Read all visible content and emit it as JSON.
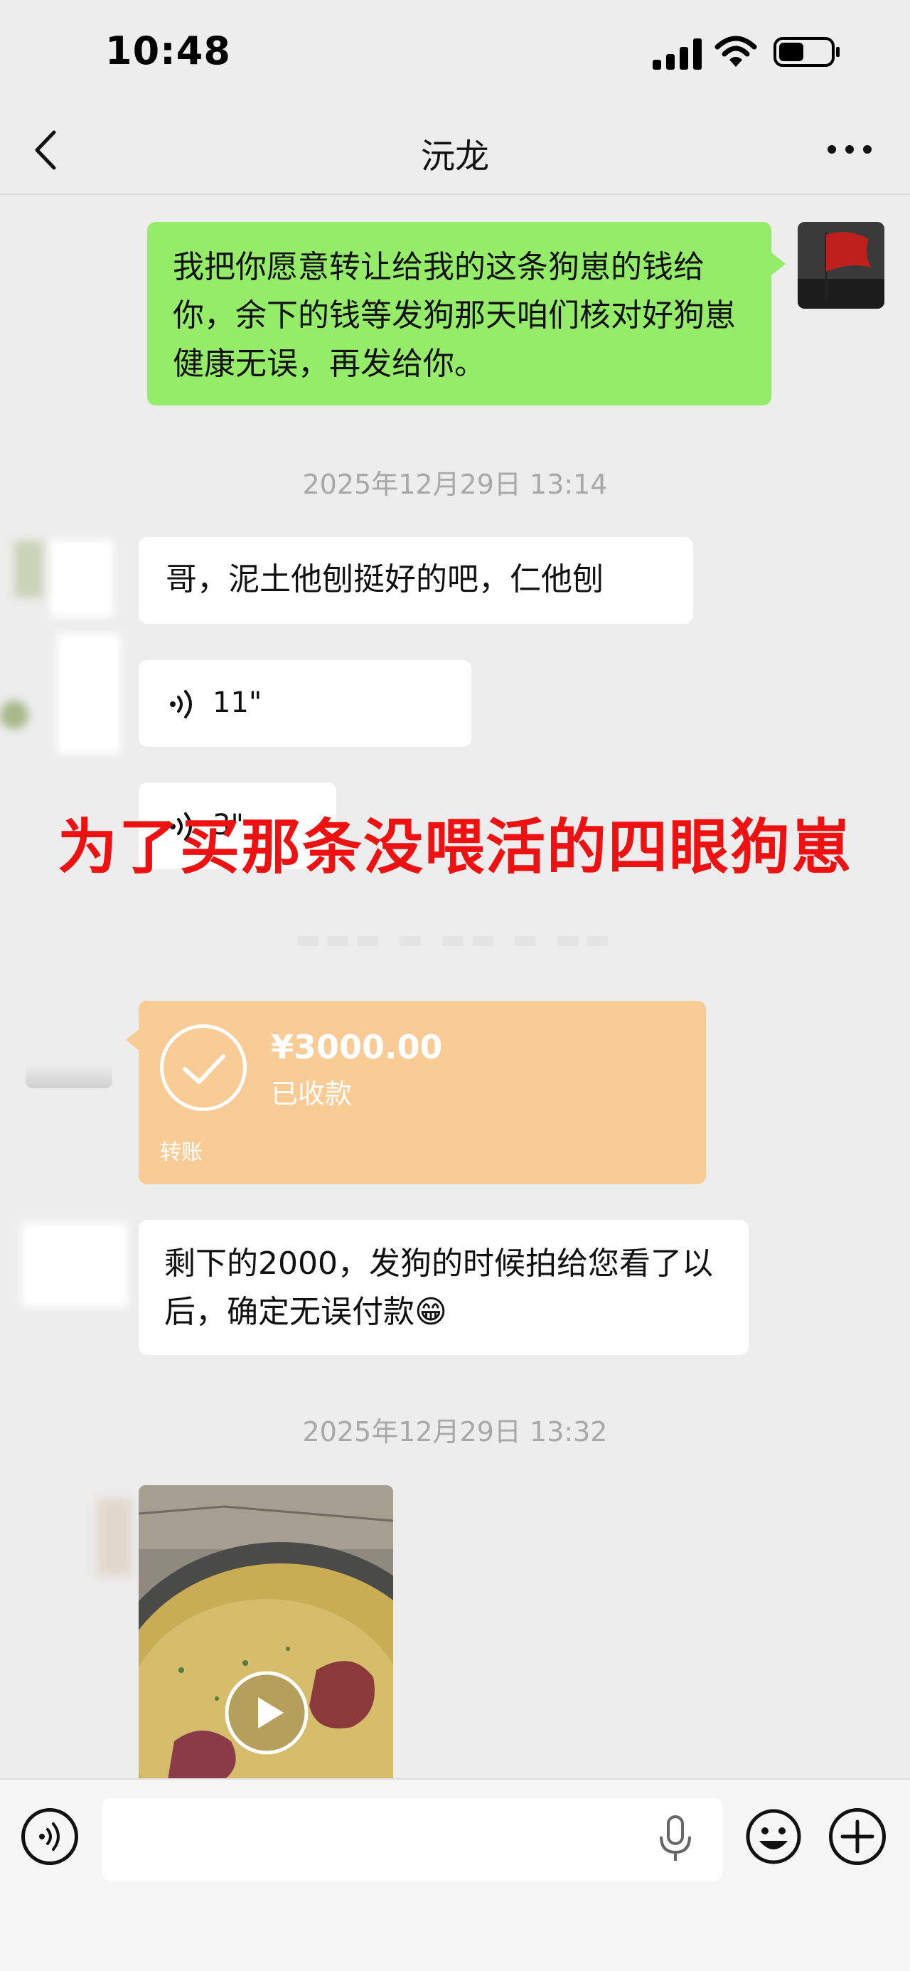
{
  "status_bar": {
    "time": "10:48",
    "battery_level": 0.45
  },
  "header": {
    "title": "沅龙",
    "back_icon": "chevron-left-icon",
    "more_icon": "more-dots-icon"
  },
  "messages": {
    "msg1": "我把你愿意转让给我的这条狗崽的钱给你，余下的钱等发狗那天咱们核对好狗崽健康无误，再发给你。",
    "timestamp1": "2025年12月29日 13:14",
    "msg2": "哥，泥土他刨挺好的吧，仁他刨",
    "voice1_duration": "11\"",
    "voice2_duration": "3\"",
    "transfer": {
      "amount": "¥3000.00",
      "status": "已收款",
      "label": "转账"
    },
    "msg3": "剩下的2000，发狗的时候拍给您看了以后，确定无误付款😁",
    "timestamp2": "2025年12月29日 13:32"
  },
  "overlay_caption": "为了买那条没喂活的四眼狗崽",
  "input_bar": {
    "placeholder": "",
    "icons": [
      "voice-icon",
      "mic-icon",
      "emoji-icon",
      "plus-icon"
    ]
  },
  "colors": {
    "my_bubble": "#95ec69",
    "transfer_card": "#f9cb95",
    "overlay_text": "#ee1111"
  }
}
